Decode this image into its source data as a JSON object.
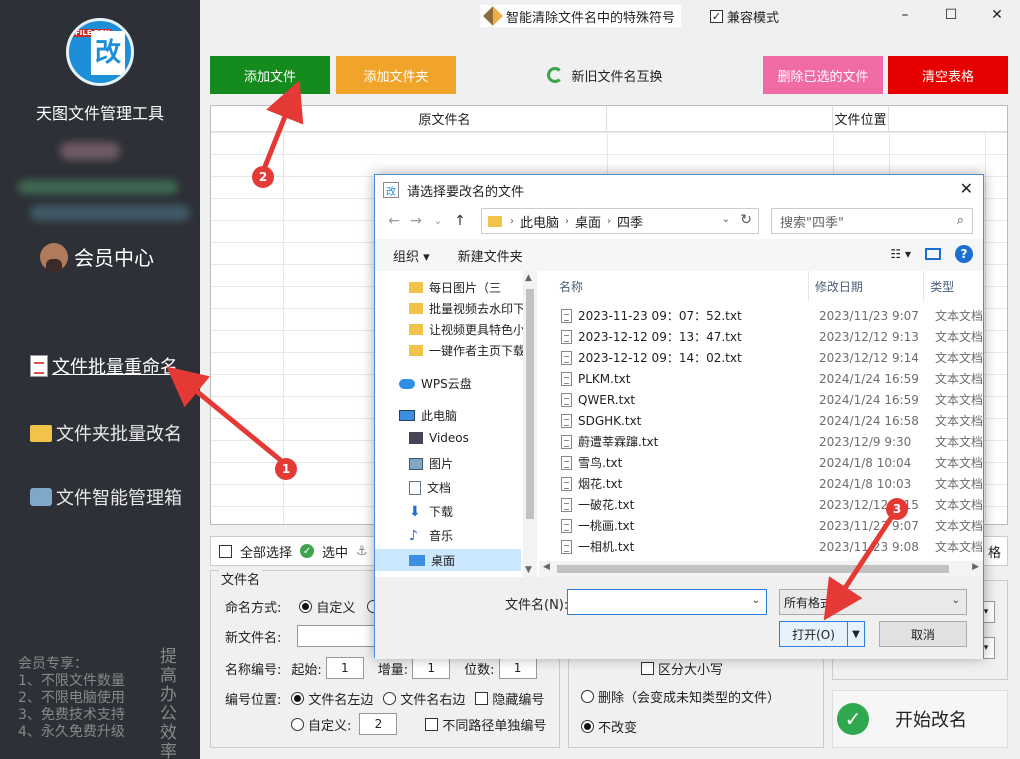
{
  "sidebar": {
    "app_title": "天图文件管理工具",
    "logo_tag": "FILE REN",
    "logo_char": "改",
    "member_center": "会员中心",
    "nav": [
      {
        "label": "文件批量重命名",
        "icon": "document-list-icon"
      },
      {
        "label": "文件夹批量改名",
        "icon": "folder-icon"
      },
      {
        "label": "文件智能管理箱",
        "icon": "toolbox-icon"
      }
    ],
    "promo_lines": [
      "会员专享：",
      "1、不限文件数量",
      "2、不限电脑使用",
      "3、免费技术支持",
      "4、永久免费升级"
    ],
    "promo_vertical": "提高办公效率"
  },
  "top": {
    "smart_clean": "智能清除文件名中的特殊符号",
    "compat_mode": "兼容模式",
    "compat_checked": "✓"
  },
  "toolbar": {
    "add_file": "添加文件",
    "add_folder": "添加文件夹",
    "swap_names": "新旧文件名互换",
    "delete_selected": "删除已选的文件",
    "clear_table": "清空表格"
  },
  "table": {
    "col_original": "原文件名",
    "col_location": "文件位置"
  },
  "selection": {
    "select_all": "全部选择",
    "select_partial": "选中",
    "trailing_text": "格"
  },
  "filename_group": {
    "title": "文件名",
    "naming_mode_label": "命名方式:",
    "custom_label": "自定义",
    "new_name_label": "新文件名:",
    "number_label": "名称编号:",
    "start_label": "起始:",
    "start_value": "1",
    "increment_label": "增量:",
    "increment_value": "1",
    "digits_label": "位数:",
    "digits_value": "1",
    "position_label": "编号位置:",
    "left_label": "文件名左边",
    "right_label": "文件名右边",
    "hide_label": "隐藏编号",
    "custom2_label": "自定义:",
    "custom2_value": "2",
    "separate_label": "不同路径单独编号"
  },
  "ext_group": {
    "case_label": "区分大小写",
    "delete_label": "删除（会变成未知类型的文件）",
    "keep_label": "不改变"
  },
  "start_button": "开始改名",
  "dialog": {
    "title": "请选择要改名的文件",
    "breadcrumbs": [
      "此电脑",
      "桌面",
      "四季"
    ],
    "search_placeholder": "搜索\"四季\"",
    "organize": "组织 ▾",
    "new_folder": "新建文件夹",
    "tree": [
      {
        "label": "每日图片（三",
        "icon": "folder-icon"
      },
      {
        "label": "批量视频去水印下",
        "icon": "folder-icon"
      },
      {
        "label": "让视频更具特色小",
        "icon": "folder-icon"
      },
      {
        "label": "一键作者主页下载",
        "icon": "folder-icon"
      },
      {
        "label": "WPS云盘",
        "icon": "cloud-icon"
      },
      {
        "label": "此电脑",
        "icon": "computer-icon"
      },
      {
        "label": "Videos",
        "icon": "video-icon"
      },
      {
        "label": "图片",
        "icon": "pictures-icon"
      },
      {
        "label": "文档",
        "icon": "documents-icon"
      },
      {
        "label": "下载",
        "icon": "download-icon"
      },
      {
        "label": "音乐",
        "icon": "music-icon"
      },
      {
        "label": "桌面",
        "icon": "desktop-icon"
      }
    ],
    "columns": {
      "name": "名称",
      "date": "修改日期",
      "type": "类型"
    },
    "files": [
      {
        "name": "2023-11-23 09：07：52.txt",
        "date": "2023/11/23 9:07",
        "type": "文本文档"
      },
      {
        "name": "2023-12-12 09：13：47.txt",
        "date": "2023/12/12 9:13",
        "type": "文本文档"
      },
      {
        "name": "2023-12-12 09：14：02.txt",
        "date": "2023/12/12 9:14",
        "type": "文本文档"
      },
      {
        "name": "PLKM.txt",
        "date": "2024/1/24 16:59",
        "type": "文本文档"
      },
      {
        "name": "QWER.txt",
        "date": "2024/1/24 16:59",
        "type": "文本文档"
      },
      {
        "name": "SDGHK.txt",
        "date": "2024/1/24 16:58",
        "type": "文本文档"
      },
      {
        "name": "蔚遭莘霖蹿.txt",
        "date": "2023/12/9 9:30",
        "type": "文本文档"
      },
      {
        "name": "雪鸟.txt",
        "date": "2024/1/8 10:04",
        "type": "文本文档"
      },
      {
        "name": "烟花.txt",
        "date": "2024/1/8 10:03",
        "type": "文本文档"
      },
      {
        "name": "一破花.txt",
        "date": "2023/12/12 9:15",
        "type": "文本文档"
      },
      {
        "name": "一桃画.txt",
        "date": "2023/11/23 9:07",
        "type": "文本文档"
      },
      {
        "name": "一相机.txt",
        "date": "2023/11/23 9:08",
        "type": "文本文档"
      }
    ],
    "filename_label": "文件名(N):",
    "filename_value": "",
    "filter": "所有格式",
    "open": "打开(O)",
    "cancel": "取消"
  },
  "annotations": {
    "badge1": "1",
    "badge2": "2",
    "badge3": "3",
    "color": "#e53935"
  }
}
